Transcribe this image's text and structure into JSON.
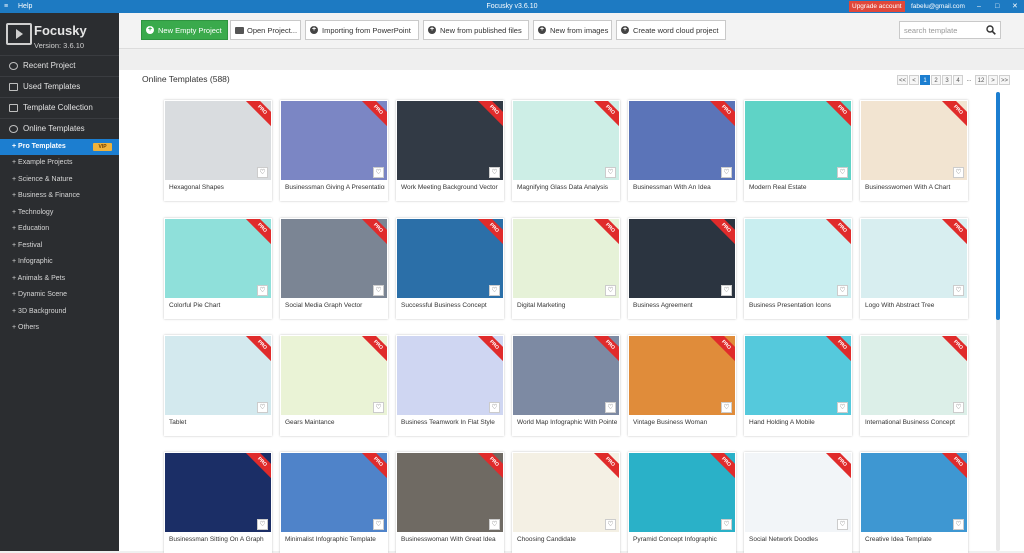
{
  "titlebar": {
    "help": "Help",
    "app": "Focusky v3.6.10",
    "upgrade": "Upgrade account",
    "email": "fabelu@gmail.com",
    "min": "–",
    "max": "□",
    "close": "✕"
  },
  "sidebar": {
    "logo_name": "Focusky",
    "version": "Version: 3.6.10",
    "nav": [
      "Recent Project",
      "Used Templates",
      "Template Collection",
      "Online Templates"
    ],
    "categories": [
      "Pro Templates",
      "Example Projects",
      "Science & Nature",
      "Business & Finance",
      "Technology",
      "Education",
      "Festival",
      "Infographic",
      "Animals & Pets",
      "Dynamic Scene",
      "3D Background",
      "Others"
    ],
    "vip": "VIP"
  },
  "toolbar": {
    "buttons": [
      "New Empty Project",
      "Open Project...",
      "Importing from PowerPoint",
      "New from published files",
      "New from images",
      "Create word cloud project"
    ],
    "search_placeholder": "search template"
  },
  "main": {
    "section_title": "Online Templates (588)",
    "pager": [
      "<<",
      "<",
      "1",
      "2",
      "3",
      "4",
      "...",
      "12",
      ">",
      ">>"
    ],
    "pro_badge": "PRO",
    "heart": "♡",
    "templates": [
      {
        "name": "Hexagonal Shapes",
        "color": "#d9dcdf"
      },
      {
        "name": "Businessman Giving A Presentation",
        "color": "#7b86c4"
      },
      {
        "name": "Work Meeting Background Vector",
        "color": "#323a45"
      },
      {
        "name": "Magnifying Glass Data Analysis",
        "color": "#cdeee6"
      },
      {
        "name": "Businessman With An Idea",
        "color": "#5b74b8"
      },
      {
        "name": "Modern Real Estate",
        "color": "#5fd3c6"
      },
      {
        "name": "Businesswomen With A Chart",
        "color": "#f2e4d1"
      },
      {
        "name": "Colorful Pie Chart",
        "color": "#8fe0da"
      },
      {
        "name": "Social Media Graph Vector",
        "color": "#7b8594"
      },
      {
        "name": "Successful Business Concept",
        "color": "#2b6fa8"
      },
      {
        "name": "Digital Marketing",
        "color": "#e6f2d8"
      },
      {
        "name": "Business Agreement",
        "color": "#2b3440"
      },
      {
        "name": "Business Presentation Icons",
        "color": "#c9eef0"
      },
      {
        "name": "Logo With Abstract Tree",
        "color": "#d8eef0"
      },
      {
        "name": "Tablet",
        "color": "#d3e9ee"
      },
      {
        "name": "Gears Maintance",
        "color": "#eaf3d6"
      },
      {
        "name": "Business Teamwork In Flat Style",
        "color": "#cfd6f2"
      },
      {
        "name": "World Map Infographic With Pointe",
        "color": "#7d8aa3"
      },
      {
        "name": "Vintage Business Woman",
        "color": "#e08c3a"
      },
      {
        "name": "Hand Holding A Mobile",
        "color": "#55c9dc"
      },
      {
        "name": "International Business Concept",
        "color": "#dcefe8"
      },
      {
        "name": "Businessman Sitting On A Graph",
        "color": "#1b2e66"
      },
      {
        "name": "Minimalist Infographic Template",
        "color": "#4f83c9"
      },
      {
        "name": "Businesswoman With Great Idea",
        "color": "#6f6a63"
      },
      {
        "name": "Choosing Candidate",
        "color": "#f4f0e4"
      },
      {
        "name": "Pyramid Concept Infographic",
        "color": "#2ab1c8"
      },
      {
        "name": "Social Network Doodles",
        "color": "#f2f5f8"
      },
      {
        "name": "Creative Idea Template",
        "color": "#3e97d2"
      }
    ]
  }
}
